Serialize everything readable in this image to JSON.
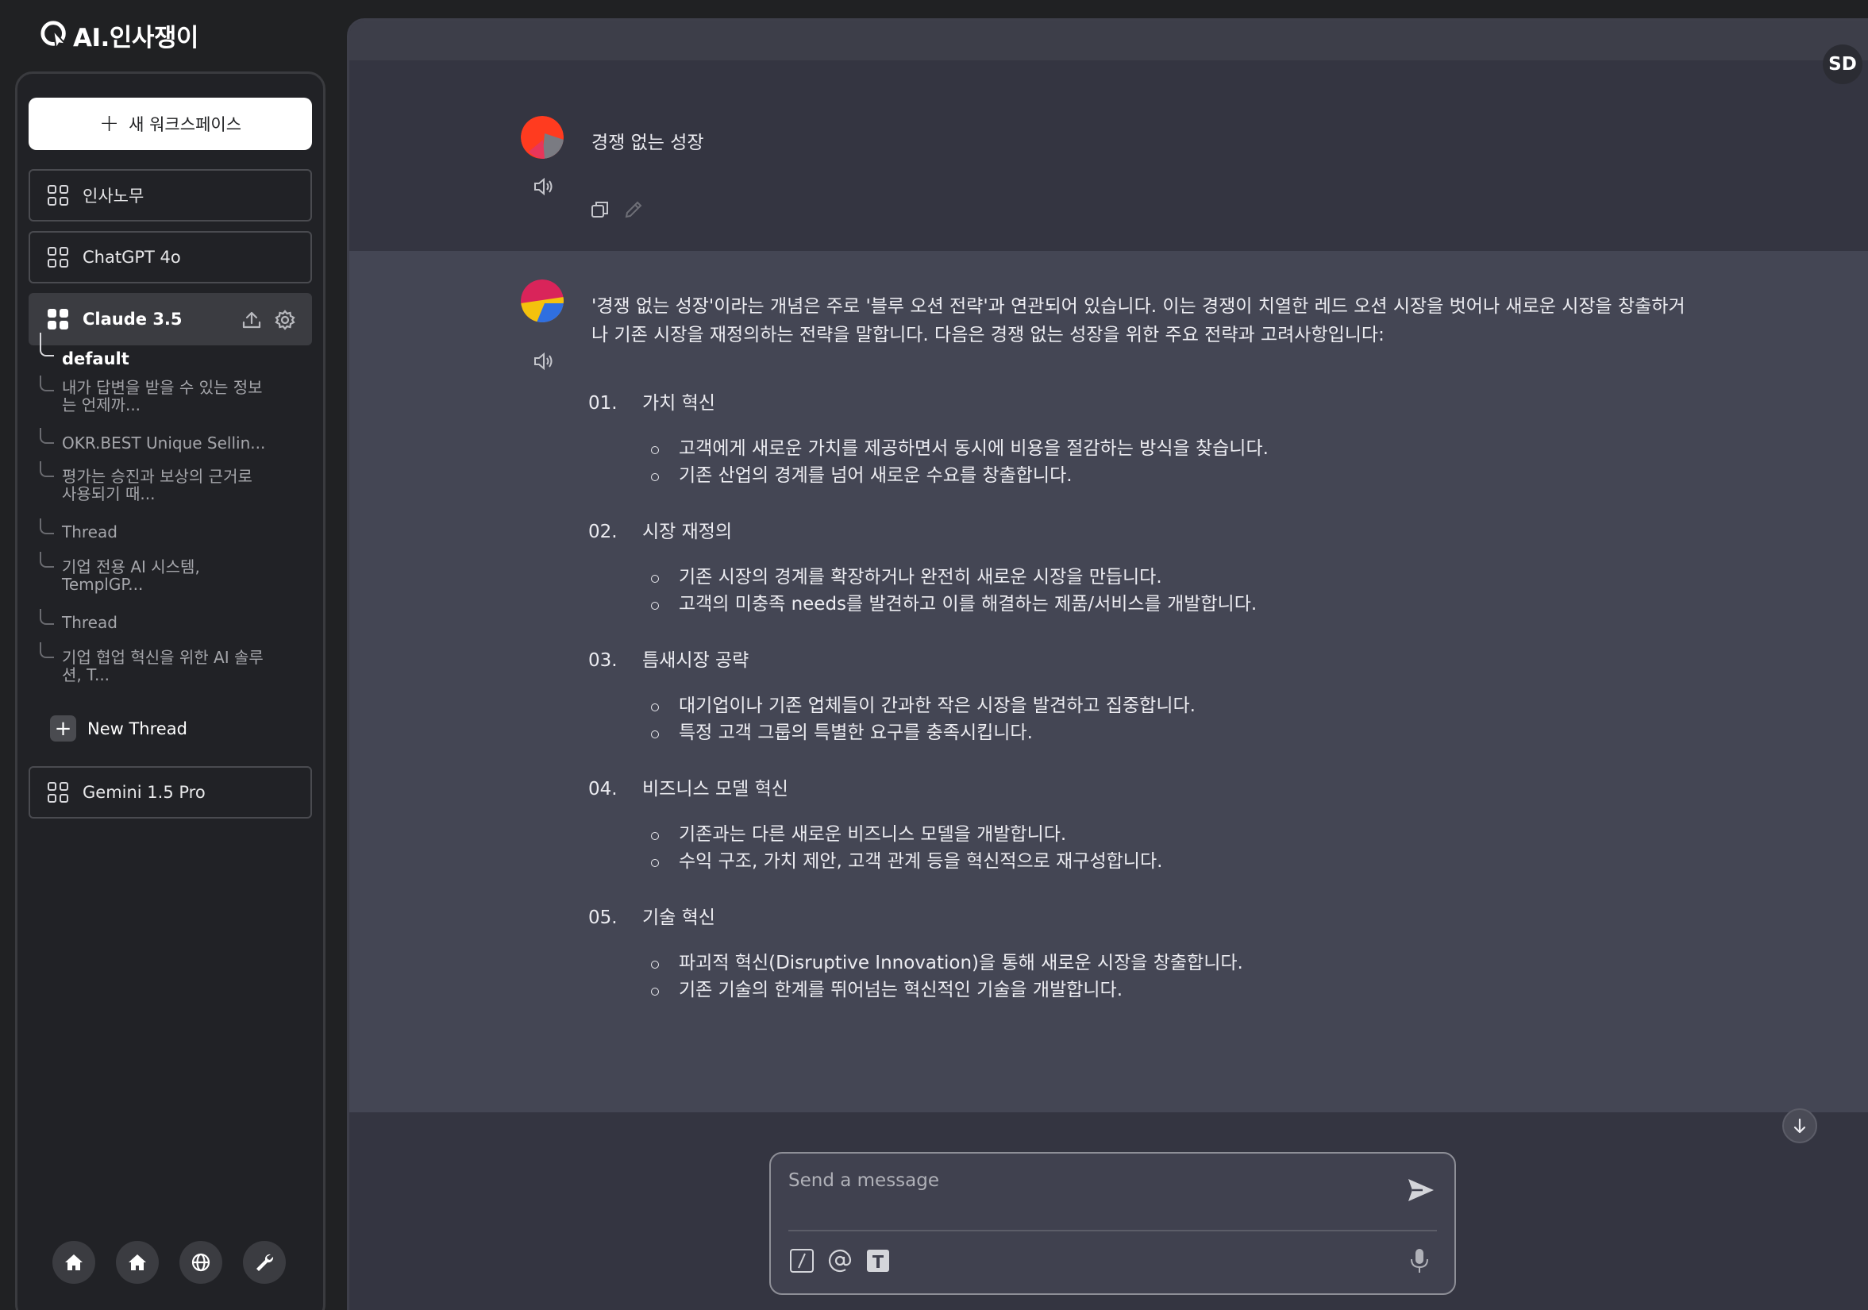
{
  "app": {
    "logo_text": "AI.인사쟁이"
  },
  "sidebar": {
    "new_workspace_label": "새 워크스페이스",
    "models": [
      {
        "label": "인사노무"
      },
      {
        "label": "ChatGPT 4o"
      },
      {
        "label": "Claude 3.5"
      },
      {
        "label": "Gemini 1.5 Pro"
      }
    ],
    "threads": [
      {
        "label": "default"
      },
      {
        "label1": "내가 답변을 받을 수 있는 정보",
        "label2": "는 언제까..."
      },
      {
        "label": "OKR.BEST Unique Sellin..."
      },
      {
        "label1": "평가는 승진과 보상의 근거로",
        "label2": "사용되기 때..."
      },
      {
        "label": "Thread"
      },
      {
        "label1": "기업 전용 AI 시스템,",
        "label2": "TemplGP..."
      },
      {
        "label": "Thread"
      },
      {
        "label1": "기업 협업 혁신을 위한 AI 솔루",
        "label2": "션, T..."
      }
    ],
    "new_thread_label": "New Thread"
  },
  "user": {
    "initials": "SD"
  },
  "conversation": {
    "user_message": "경쟁 없는 성장",
    "assistant_intro": "'경쟁 없는 성장'이라는 개념은 주로 '블루 오션 전략'과 연관되어 있습니다. 이는 경쟁이 치열한 레드 오션 시장을 벗어나 새로운 시장을 창출하거나 기존 시장을 재정의하는 전략을 말합니다. 다음은 경쟁 없는 성장을 위한 주요 전략과 고려사항입니다:",
    "sections": [
      {
        "num": "01.",
        "title": "가치 혁신",
        "bullets": [
          "고객에게 새로운 가치를 제공하면서 동시에 비용을 절감하는 방식을 찾습니다.",
          "기존 산업의 경계를 넘어 새로운 수요를 창출합니다."
        ]
      },
      {
        "num": "02.",
        "title": "시장 재정의",
        "bullets": [
          "기존 시장의 경계를 확장하거나 완전히 새로운 시장을 만듭니다.",
          "고객의 미충족 needs를 발견하고 이를 해결하는 제품/서비스를 개발합니다."
        ]
      },
      {
        "num": "03.",
        "title": "틈새시장 공략",
        "bullets": [
          "대기업이나 기존 업체들이 간과한 작은 시장을 발견하고 집중합니다.",
          "특정 고객 그룹의 특별한 요구를 충족시킵니다."
        ]
      },
      {
        "num": "04.",
        "title": "비즈니스 모델 혁신",
        "bullets": [
          "기존과는 다른 새로운 비즈니스 모델을 개발합니다.",
          "수익 구조, 가치 제안, 고객 관계 등을 혁신적으로 재구성합니다."
        ]
      },
      {
        "num": "05.",
        "title": "기술 혁신",
        "bullets": [
          "파괴적 혁신(Disruptive Innovation)을 통해 새로운 시장을 창출합니다.",
          "기존 기술의 한계를 뛰어넘는 혁신적인 기술을 개발합니다."
        ]
      }
    ]
  },
  "composer": {
    "placeholder": "Send a message"
  },
  "icons": {
    "sidebar_bottom": [
      "home-icon",
      "home-icon",
      "globe-icon",
      "wrench-icon"
    ],
    "composer_tools": [
      "slash-command-icon",
      "at-mention-icon",
      "text-format-icon"
    ]
  },
  "colors": {
    "accent_red": "#ff3b1f",
    "background": "#343541",
    "assistant_bg": "#444654"
  }
}
